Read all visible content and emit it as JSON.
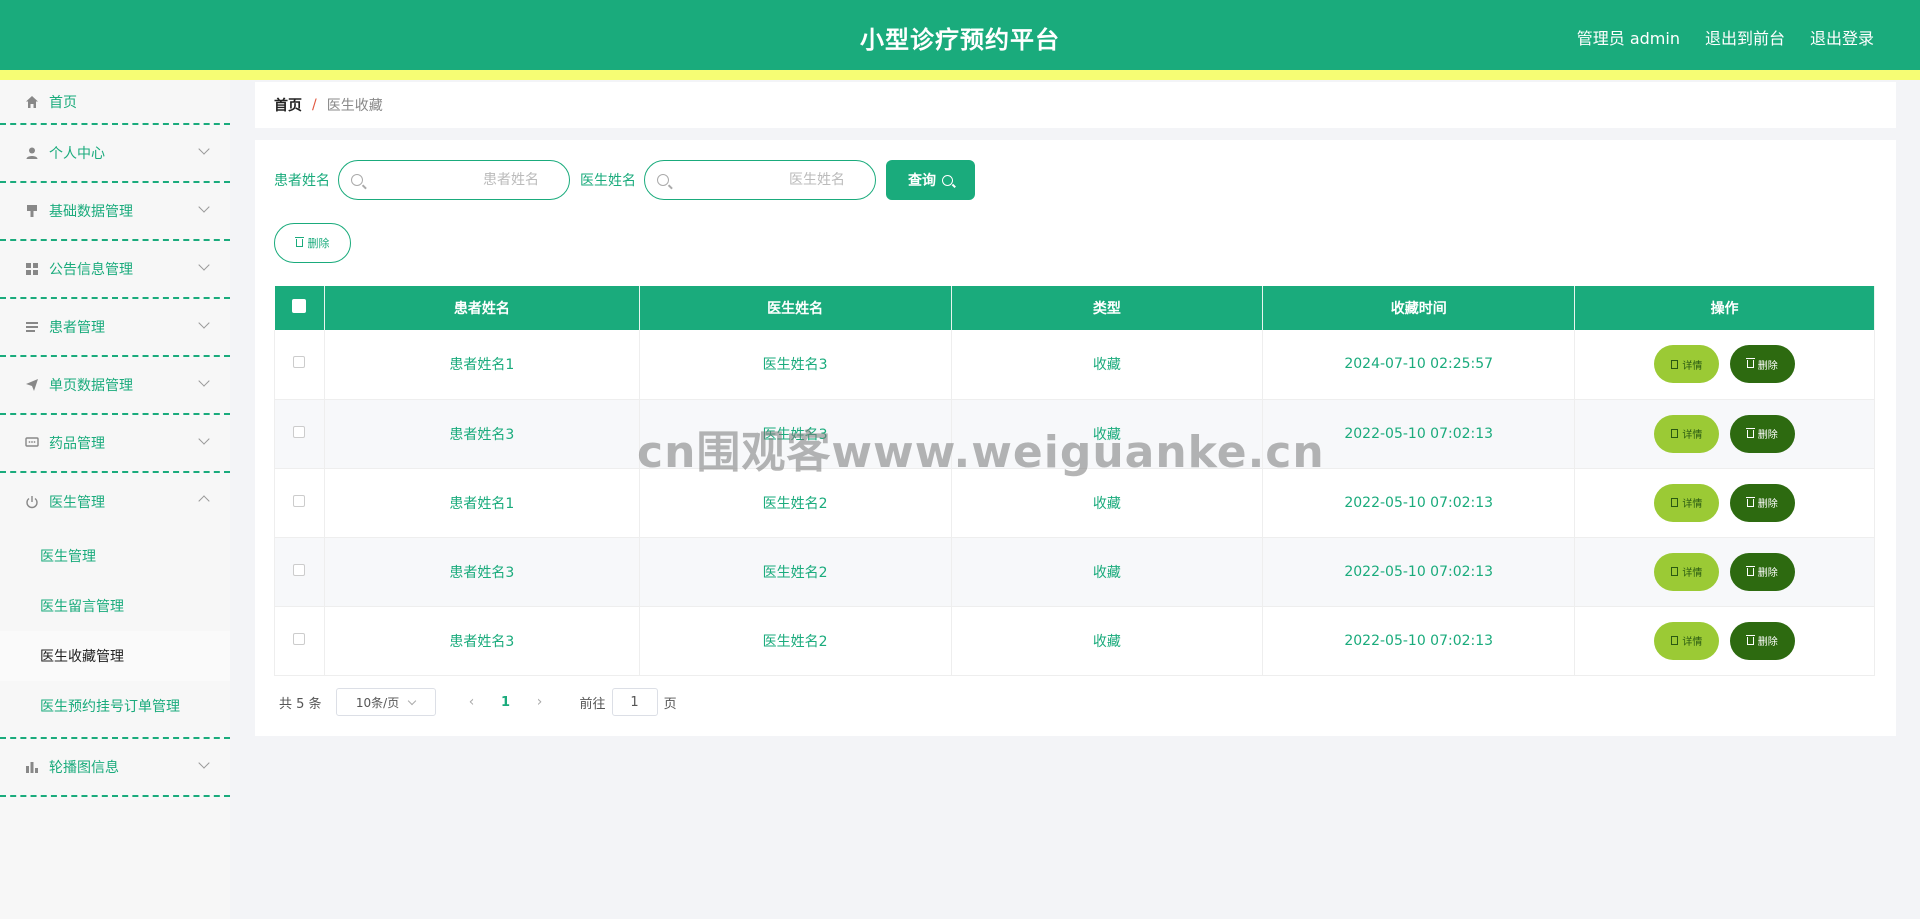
{
  "header": {
    "title": "小型诊疗预约平台",
    "user_label": "管理员 admin",
    "front_link": "退出到前台",
    "logout_link": "退出登录",
    "bg_color": "#1aab7c",
    "stripe_color": "#f6fd74"
  },
  "sidebar": {
    "items": [
      {
        "label": "首页",
        "icon": "home-icon"
      },
      {
        "label": "个人中心",
        "icon": "user-icon"
      },
      {
        "label": "基础数据管理",
        "icon": "brush-icon"
      },
      {
        "label": "公告信息管理",
        "icon": "grid-icon"
      },
      {
        "label": "患者管理",
        "icon": "list-icon"
      },
      {
        "label": "单页数据管理",
        "icon": "send-icon"
      },
      {
        "label": "药品管理",
        "icon": "chat-icon"
      },
      {
        "label": "医生管理",
        "icon": "power-icon"
      },
      {
        "label": "轮播图信息",
        "icon": "bar-chart-icon"
      }
    ],
    "submenu": [
      "医生管理",
      "医生留言管理",
      "医生收藏管理",
      "医生预约挂号订单管理"
    ],
    "active_sub": "医生收藏管理"
  },
  "breadcrumb": {
    "home": "首页",
    "separator": "/",
    "current": "医生收藏"
  },
  "search": {
    "patient_label": "患者姓名",
    "patient_placeholder": "患者姓名",
    "doctor_label": "医生姓名",
    "doctor_placeholder": "医生姓名",
    "query_button": "查询"
  },
  "batch_delete_label": "删除",
  "table": {
    "columns": [
      "患者姓名",
      "医生姓名",
      "类型",
      "收藏时间",
      "操作"
    ],
    "rows": [
      {
        "patient": "患者姓名1",
        "doctor": "医生姓名3",
        "type": "收藏",
        "time": "2024-07-10 02:25:57"
      },
      {
        "patient": "患者姓名3",
        "doctor": "医生姓名3",
        "type": "收藏",
        "time": "2022-05-10 07:02:13"
      },
      {
        "patient": "患者姓名1",
        "doctor": "医生姓名2",
        "type": "收藏",
        "time": "2022-05-10 07:02:13"
      },
      {
        "patient": "患者姓名3",
        "doctor": "医生姓名2",
        "type": "收藏",
        "time": "2022-05-10 07:02:13"
      },
      {
        "patient": "患者姓名3",
        "doctor": "医生姓名2",
        "type": "收藏",
        "time": "2022-05-10 07:02:13"
      }
    ],
    "detail_label": "详情",
    "delete_label": "删除"
  },
  "pagination": {
    "total": "共 5 条",
    "page_size": "10条/页",
    "current_page": "1",
    "goto_label": "前往",
    "goto_value": "1",
    "page_suffix": "页"
  },
  "watermark": "cn围观客www.weiguanke.cn"
}
